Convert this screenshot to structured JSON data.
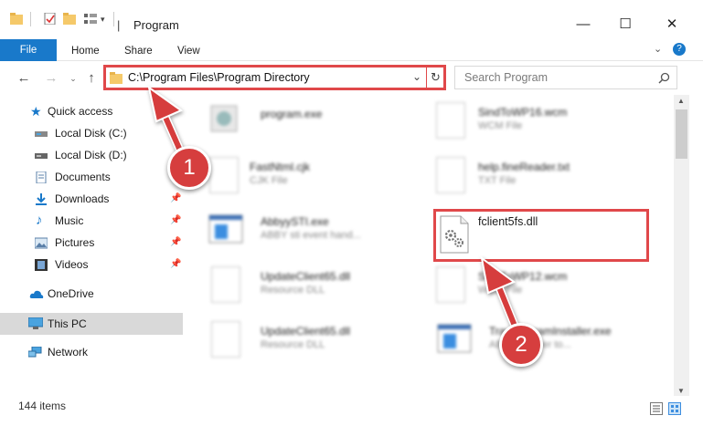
{
  "window": {
    "title": "Program",
    "controls": {
      "minimize": "—",
      "maximize": "☐",
      "close": "✕"
    }
  },
  "ribbon": {
    "tabs": [
      "File",
      "Home",
      "Share",
      "View"
    ],
    "help": "?"
  },
  "address_bar": {
    "path": "C:\\Program Files\\Program Directory",
    "dropdown": "⌄",
    "refresh": "↻"
  },
  "search": {
    "placeholder": "Search Program"
  },
  "navigation": {
    "items": [
      {
        "label": "Quick access",
        "icon": "star-icon",
        "pinned": false
      },
      {
        "label": "Local Disk (C:)",
        "icon": "drive-icon",
        "pinned": false
      },
      {
        "label": "Local Disk (D:)",
        "icon": "drive-icon",
        "pinned": false
      },
      {
        "label": "Documents",
        "icon": "documents-icon",
        "pinned": true
      },
      {
        "label": "Downloads",
        "icon": "download-icon",
        "pinned": true
      },
      {
        "label": "Music",
        "icon": "music-icon",
        "pinned": true
      },
      {
        "label": "Pictures",
        "icon": "pictures-icon",
        "pinned": true
      },
      {
        "label": "Videos",
        "icon": "videos-icon",
        "pinned": true
      },
      {
        "label": "OneDrive",
        "icon": "cloud-icon",
        "pinned": false
      },
      {
        "label": "This PC",
        "icon": "computer-icon",
        "pinned": false,
        "selected": true
      },
      {
        "label": "Network",
        "icon": "network-icon",
        "pinned": false
      }
    ]
  },
  "files": [
    {
      "name": "program.exe",
      "type": ""
    },
    {
      "name": "SindToWP16.wcm",
      "type": "WCM File"
    },
    {
      "name": "FastNtml.cjk",
      "type": "CJK File"
    },
    {
      "name": "help.fineReader.txt",
      "type": "TXT File"
    },
    {
      "name": "AbbyySTI.exe",
      "type": "ABBY sti event hand..."
    },
    {
      "name": "fclient5fs.dll",
      "type": ""
    },
    {
      "name": "UpdateClient65.dll",
      "type": "Resource DLL"
    },
    {
      "name": "SindToWP12.wcm",
      "type": "WCM File"
    },
    {
      "name": "UpdateClient65.dll",
      "type": "Resource DLL"
    },
    {
      "name": "TrayProgramInstaller.exe",
      "type": "ABBY Reader to..."
    }
  ],
  "status": {
    "item_count": "144 items"
  },
  "callouts": [
    "1",
    "2"
  ],
  "colors": {
    "accent": "#1979ca",
    "highlight": "#e0484a",
    "callout": "#d63e3e"
  }
}
